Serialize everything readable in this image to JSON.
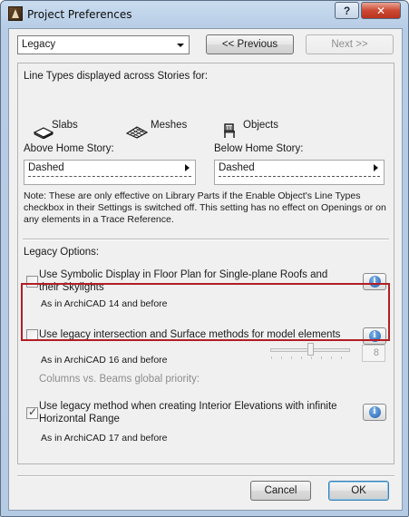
{
  "window": {
    "title": "Project Preferences",
    "help_label": "?",
    "close_label": "✕"
  },
  "toolbar": {
    "preset_value": "Legacy",
    "previous_label": "<< Previous",
    "next_label": "Next >>"
  },
  "line_types": {
    "heading": "Line Types displayed across Stories for:",
    "items": [
      {
        "label": "Slabs",
        "icon": "slab-icon"
      },
      {
        "label": "Meshes",
        "icon": "mesh-icon"
      },
      {
        "label": "Objects",
        "icon": "chair-icon"
      }
    ],
    "above": {
      "label": "Above Home Story:",
      "value": "Dashed"
    },
    "below": {
      "label": "Below Home Story:",
      "value": "Dashed"
    },
    "note": "Note: These are only effective on Library Parts if the Enable Object's Line Types checkbox in their Settings is switched off. This setting has no effect on Openings or on any elements in a Trace Reference."
  },
  "legacy": {
    "heading": "Legacy Options:",
    "options": [
      {
        "label": "Use Symbolic Display in Floor Plan for Single-plane Roofs and their Skylights",
        "sub": "As in ArchiCAD 14 and before",
        "checked": false
      },
      {
        "label": "Use legacy intersection and Surface methods for model elements",
        "sub": "As in ArchiCAD 16 and before",
        "checked": false
      },
      {
        "label": "Use legacy method when creating Interior Elevations with infinite Horizontal Range",
        "sub": "As in ArchiCAD 17 and before",
        "checked": true
      }
    ],
    "priority": {
      "label": "Columns vs. Beams global priority:",
      "value": "8"
    }
  },
  "footer": {
    "cancel_label": "Cancel",
    "ok_label": "OK"
  },
  "colors": {
    "highlight_border": "#b21e24",
    "info_icon": "#1f5fb0"
  }
}
